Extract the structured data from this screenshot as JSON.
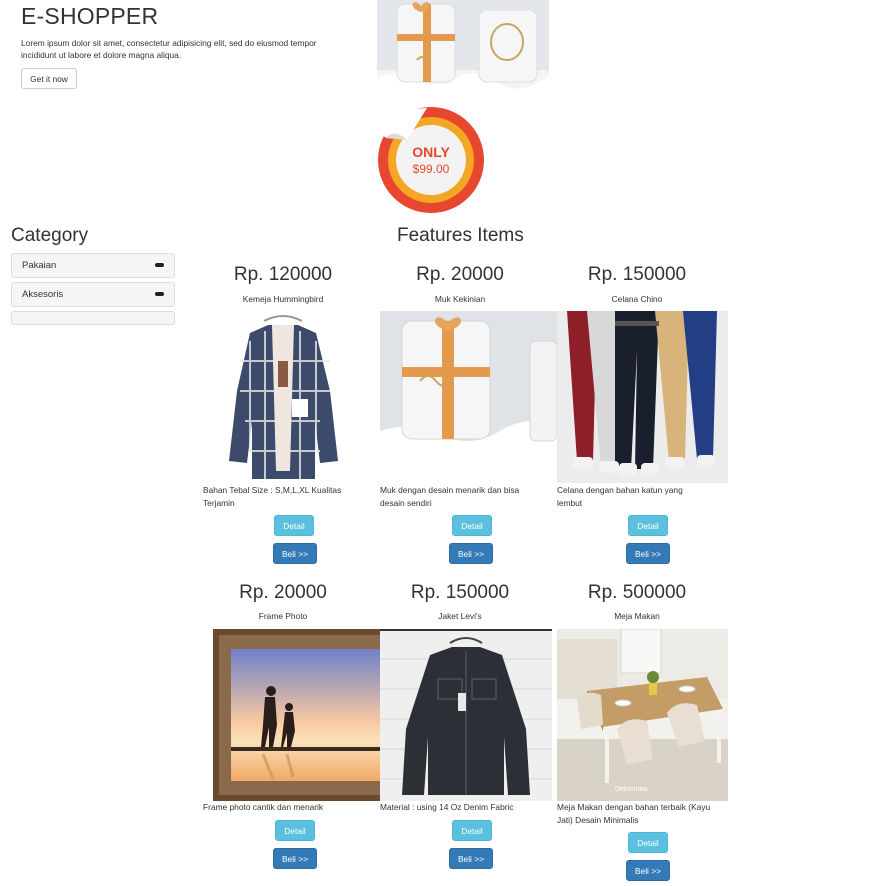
{
  "hero": {
    "brand": "E-SHOPPER",
    "text": "Lorem ipsum dolor sit amet, consectetur adipisicing elit, sed do eiusmod tempor incididunt ut labore et dolore magna aliqua.",
    "cta_label": "Get it now",
    "badge": {
      "only": "ONLY",
      "price": "$99.00"
    }
  },
  "sidebar": {
    "title": "Category",
    "items": [
      {
        "label": "Pakaian"
      },
      {
        "label": "Aksesoris"
      }
    ]
  },
  "features": {
    "title": "Features Items",
    "detail_label": "Detail",
    "buy_label": "Beli >>",
    "products": [
      {
        "price": "Rp. 120000",
        "name": "Kemeja Hummingbird",
        "description": "Bahan Tebal Size : S,M,L,XL Kualitas Terjamin",
        "image": "plaid-shirt"
      },
      {
        "price": "Rp. 20000",
        "name": "Muk Kekinian",
        "description": "Muk dengan desain menarik dan bisa desain sendiri",
        "image": "mugs"
      },
      {
        "price": "Rp. 150000",
        "name": "Celana Chino",
        "description": "Celana dengan bahan katun yang lembut",
        "image": "chino-pants"
      },
      {
        "price": "Rp. 20000",
        "name": "Frame Photo",
        "description": "Frame photo cantik dan menarik",
        "image": "photo-frame"
      },
      {
        "price": "Rp. 150000",
        "name": "Jaket Levi's",
        "description": "Material : using 14 Oz Denim Fabric",
        "image": "denim-jacket"
      },
      {
        "price": "Rp. 500000",
        "name": "Meja Makan",
        "description": "Meja Makan dengan bahan terbaik (Kayu Jati) Desain Minimalis",
        "image": "dining-table",
        "image_watermark": "Dekoruma"
      }
    ]
  }
}
